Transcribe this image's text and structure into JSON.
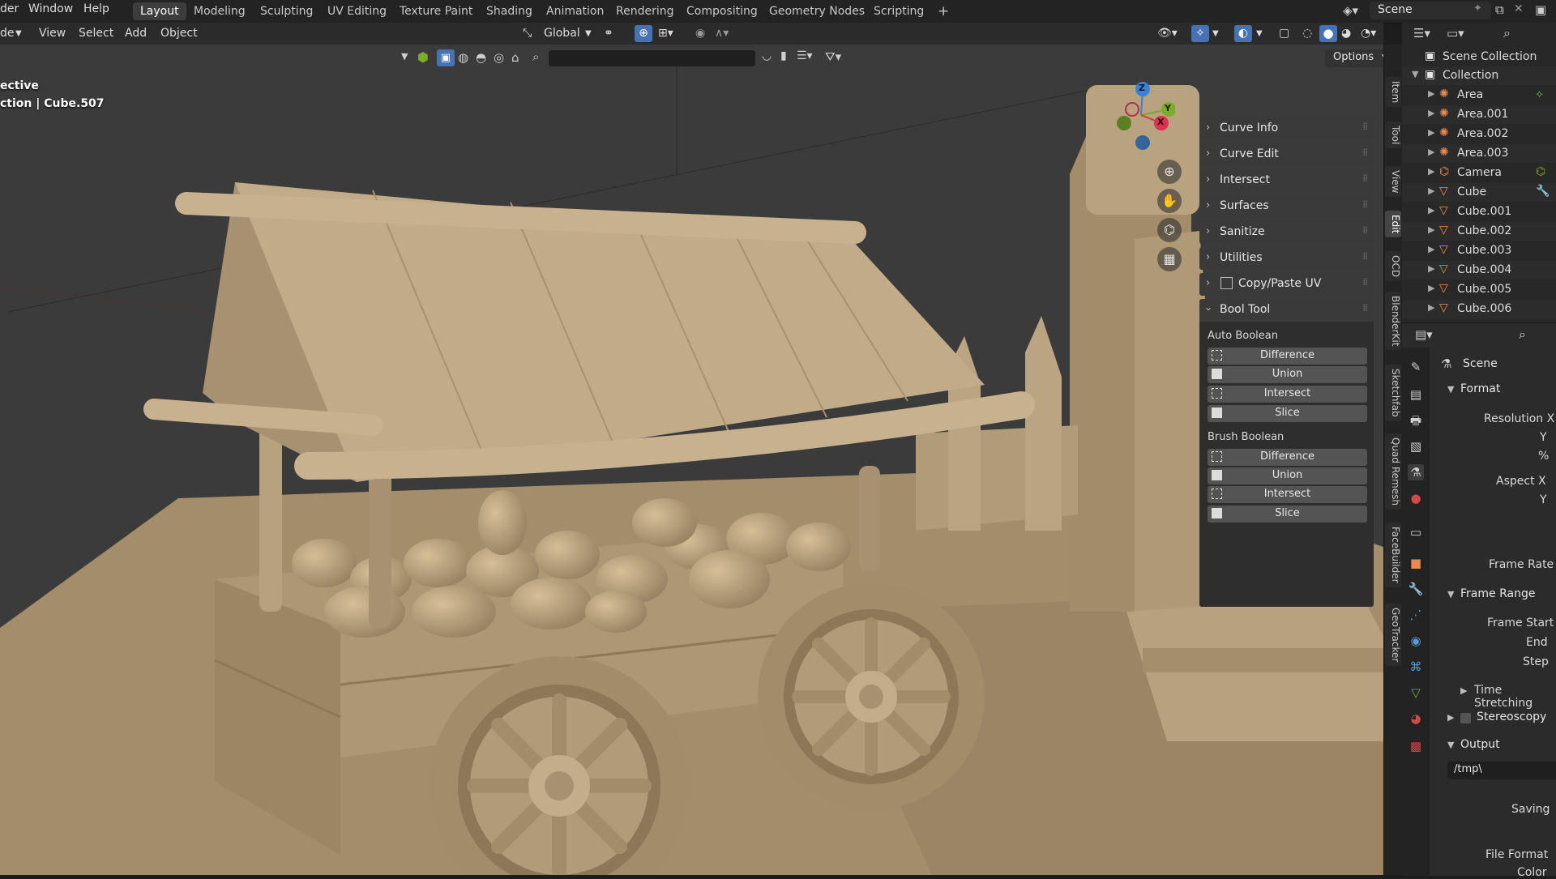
{
  "topbar": {
    "menus": [
      "der",
      "Window",
      "Help"
    ],
    "workspaces": [
      "Layout",
      "Modeling",
      "Sculpting",
      "UV Editing",
      "Texture Paint",
      "Shading",
      "Animation",
      "Rendering",
      "Compositing",
      "Geometry Nodes",
      "Scripting"
    ],
    "add_tab": "+",
    "scene_name": "Scene"
  },
  "viewport_header": {
    "mode_label": "de",
    "menus": [
      "View",
      "Select",
      "Add",
      "Object"
    ],
    "transform_orientation": "Global",
    "options_label": "Options"
  },
  "viewport_overlay": {
    "view_name": "ective",
    "collection_object": "ction | Cube.507"
  },
  "gizmo": {
    "axes": [
      "Z",
      "Y",
      "X"
    ],
    "colors": {
      "x": "#e0304f",
      "y": "#7bab2a",
      "z": "#3b82d6"
    }
  },
  "npanel": {
    "sections": [
      "Curve Info",
      "Curve Edit",
      "Intersect",
      "Surfaces",
      "Sanitize",
      "Utilities",
      "Copy/Paste UV"
    ],
    "bool_tool": {
      "title": "Bool Tool",
      "auto_label": "Auto Boolean",
      "auto_buttons": [
        "Difference",
        "Union",
        "Intersect",
        "Slice"
      ],
      "brush_label": "Brush Boolean",
      "brush_buttons": [
        "Difference",
        "Union",
        "Intersect",
        "Slice"
      ]
    }
  },
  "sidebar_tabs": [
    "Item",
    "Tool",
    "View",
    "Edit",
    "OCD",
    "BlenderKit",
    "Sketchfab",
    "Quad Remesh",
    "FaceBuilder",
    "GeoTracker"
  ],
  "outliner": {
    "root": "Scene Collection",
    "collection": "Collection",
    "items": [
      {
        "name": "Area",
        "type": "light"
      },
      {
        "name": "Area.001",
        "type": "light"
      },
      {
        "name": "Area.002",
        "type": "light"
      },
      {
        "name": "Area.003",
        "type": "light"
      },
      {
        "name": "Camera",
        "type": "camera"
      },
      {
        "name": "Cube",
        "type": "mesh"
      },
      {
        "name": "Cube.001",
        "type": "mesh"
      },
      {
        "name": "Cube.002",
        "type": "mesh"
      },
      {
        "name": "Cube.003",
        "type": "mesh"
      },
      {
        "name": "Cube.004",
        "type": "mesh"
      },
      {
        "name": "Cube.005",
        "type": "mesh"
      },
      {
        "name": "Cube.006",
        "type": "mesh"
      }
    ]
  },
  "properties": {
    "context": "Scene",
    "format_title": "Format",
    "resolution_x": "Resolution X",
    "y": "Y",
    "percent": "%",
    "aspect_x": "Aspect X",
    "aspect_y": "Y",
    "frame_rate": "Frame Rate",
    "frame_range_title": "Frame Range",
    "frame_start": "Frame Start",
    "end": "End",
    "step": "Step",
    "time_stretching": "Time Stretching",
    "stereoscopy": "Stereoscopy",
    "output_title": "Output",
    "output_path": "/tmp\\",
    "saving": "Saving",
    "file_format": "File Format",
    "color": "Color"
  }
}
